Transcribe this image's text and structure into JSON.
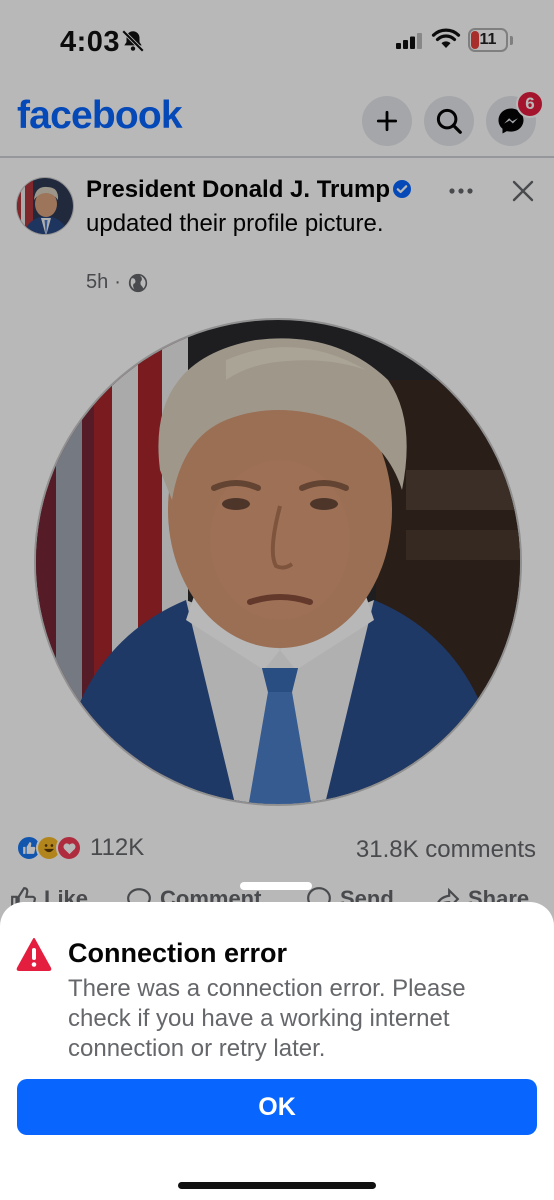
{
  "status_bar": {
    "time": "4:03",
    "battery_level": "11",
    "icons": [
      "bell-slash-icon",
      "signal-icon",
      "wifi-icon",
      "battery-icon"
    ]
  },
  "header": {
    "logo": "facebook",
    "messenger_badge": "6",
    "icons": [
      "plus-icon",
      "search-icon",
      "messenger-icon"
    ]
  },
  "post": {
    "author": "President Donald J. Trump",
    "action_text": "updated their profile picture.",
    "time": "5h",
    "audience_icon": "globe-icon",
    "reaction_count": "112K",
    "comments": "31.8K comments",
    "actions": [
      {
        "label": "Like",
        "icon": "thumbs-up-icon"
      },
      {
        "label": "Comment",
        "icon": "comment-icon"
      },
      {
        "label": "Send",
        "icon": "messenger-icon"
      },
      {
        "label": "Share",
        "icon": "share-icon"
      }
    ]
  },
  "dialog": {
    "title": "Connection error",
    "message": "There was a connection error. Please check if you have a working internet connection or retry later.",
    "ok_label": "OK",
    "icon": "warning-icon"
  },
  "colors": {
    "brand_blue": "#0866ff",
    "error_red": "#e41e3f",
    "secondary_text": "#65676b"
  }
}
